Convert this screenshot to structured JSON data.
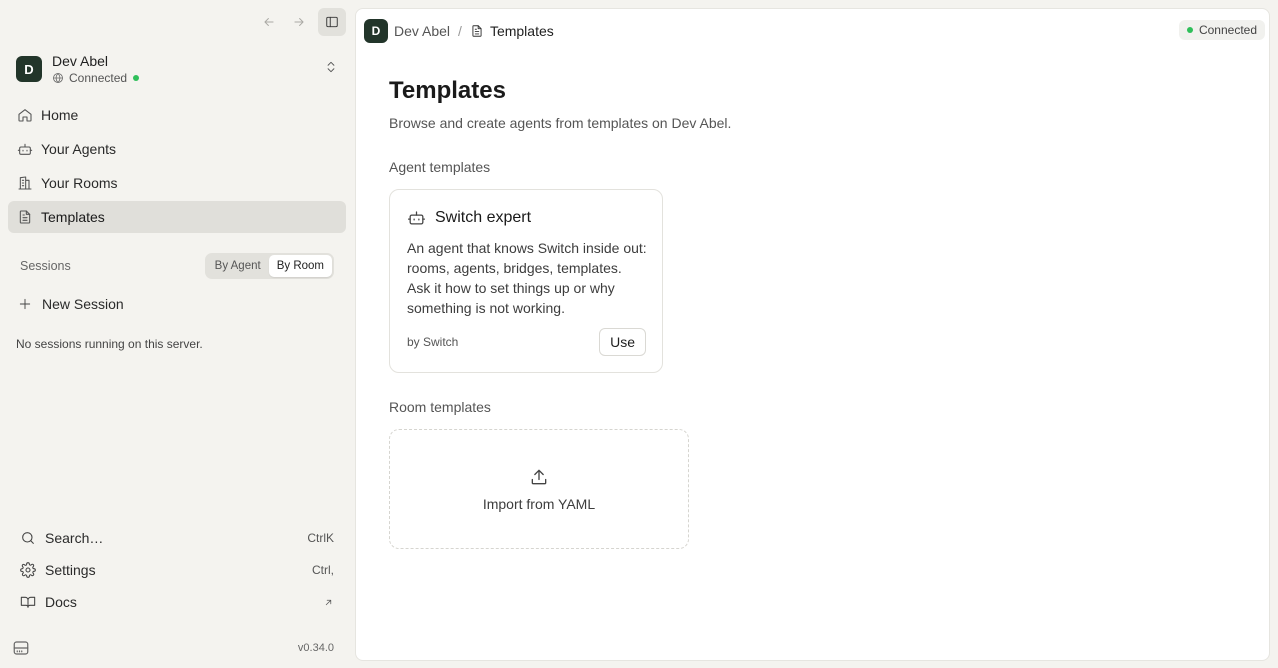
{
  "account": {
    "initial": "D",
    "name": "Dev Abel",
    "status": "Connected"
  },
  "nav": {
    "items": [
      {
        "label": "Home",
        "icon": "home-icon"
      },
      {
        "label": "Your Agents",
        "icon": "bot-icon"
      },
      {
        "label": "Your Rooms",
        "icon": "building-icon"
      },
      {
        "label": "Templates",
        "icon": "file-text-icon",
        "active": true
      }
    ]
  },
  "sessions": {
    "label": "Sessions",
    "toggle": [
      "By Agent",
      "By Room"
    ],
    "toggle_selected": "By Room",
    "new_label": "New Session",
    "empty_text": "No sessions running on this server."
  },
  "bottom": {
    "search_label": "Search…",
    "search_kbd": "CtrlK",
    "settings_label": "Settings",
    "settings_kbd": "Ctrl,",
    "docs_label": "Docs",
    "version": "v0.34.0"
  },
  "header": {
    "crumb_initial": "D",
    "crumb_root": "Dev Abel",
    "crumb_sep": "/",
    "crumb_current": "Templates",
    "connection": "Connected"
  },
  "page": {
    "title": "Templates",
    "subtitle": "Browse and create agents from templates on Dev Abel.",
    "agent_section": "Agent templates",
    "room_section": "Room templates"
  },
  "agent_card": {
    "title": "Switch expert",
    "description": "An agent that knows Switch inside out: rooms, agents, bridges, templates. Ask it how to set things up or why something is not working.",
    "author": "by Switch",
    "use_label": "Use"
  },
  "import": {
    "label": "Import from YAML"
  },
  "colors": {
    "accent_dark": "#22352a",
    "status_green": "#2fbf5a",
    "sidebar_bg": "#f4f3ef",
    "active_item_bg": "#e0dfda"
  }
}
